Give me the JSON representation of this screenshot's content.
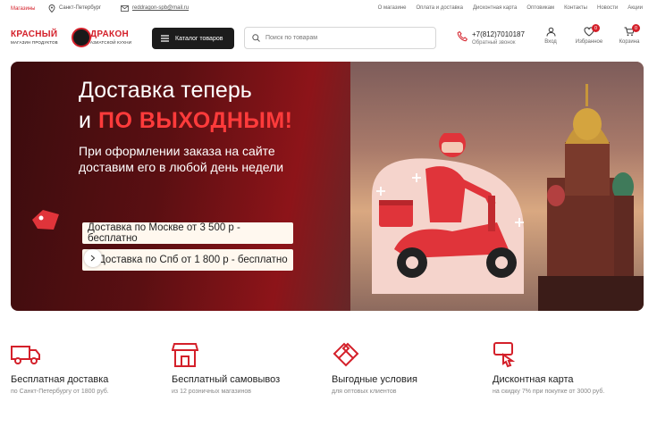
{
  "topbar": {
    "shops_label": "Магазины",
    "city": "Санкт-Петербург",
    "email": "reddragon-spb@mail.ru",
    "nav": [
      "О магазине",
      "Оплата и доставка",
      "Дисконтная карта",
      "Оптовикам",
      "Контакты",
      "Новости",
      "Акции"
    ]
  },
  "header": {
    "logo": {
      "left_title": "КРАСНЫЙ",
      "left_sub": "МАГАЗИН ПРОДУКТОВ",
      "right_title": "ДРАКОН",
      "right_sub": "АЗИАТСКОЙ КУХНИ"
    },
    "catalog_button": "Каталог товаров",
    "search_placeholder": "Поиск по товарам",
    "phone": "+7(812)7010187",
    "callback": "Обратный звонок",
    "icons": [
      {
        "label": "Вход",
        "icon": "user-icon"
      },
      {
        "label": "Избранное",
        "icon": "heart-icon",
        "badge": "0"
      },
      {
        "label": "Корзина",
        "icon": "cart-icon",
        "badge": "0"
      }
    ]
  },
  "banner": {
    "line1": "Доставка теперь",
    "line2_prefix": "и",
    "line2_highlight": "ПО ВЫХОДНЫМ!",
    "sub1": "При оформлении заказа на сайте",
    "sub2": "доставим его в любой день недели",
    "pill1": "Доставка по Москве от 3 500 р - бесплатно",
    "pill2": "Доставка по Спб от 1 800 р - бесплатно"
  },
  "features": [
    {
      "title": "Бесплатная доставка",
      "subtitle": "по Санкт-Петербургу от 1800 руб.",
      "icon": "truck-icon"
    },
    {
      "title": "Бесплатный самовывоз",
      "subtitle": "из 12 розничных магазинов",
      "icon": "store-icon"
    },
    {
      "title": "Выгодные условия",
      "subtitle": "для оптовых клиентов",
      "icon": "handshake-icon"
    },
    {
      "title": "Дисконтная карта",
      "subtitle": "на скидку 7% при покупке от 3000 руб.",
      "icon": "discount-card-icon"
    }
  ],
  "colors": {
    "accent": "#d4202a",
    "dark": "#1c1c1c"
  }
}
